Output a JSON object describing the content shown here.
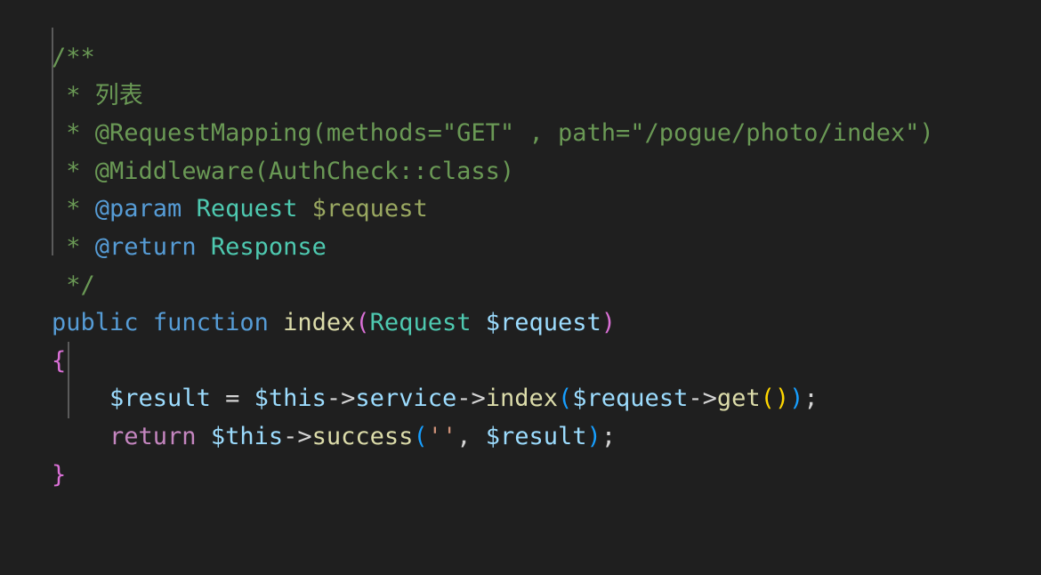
{
  "editor": {
    "language": "php",
    "background": "#1f1f1f",
    "font_size_px": 27,
    "line_height_px": 42.6,
    "theme": "dark-plus"
  },
  "colors": {
    "comment": "#6a9955",
    "doc_tag": "#569cd6",
    "doc_type": "#4ec9b0",
    "doc_variable": "#9aa861",
    "keyword": "#569cd6",
    "control_keyword": "#c586c0",
    "function": "#dcdcaa",
    "variable": "#9cdcfe",
    "string": "#ce9178",
    "operator": "#d4d4d4",
    "bracket_level_1": "#ffd700",
    "bracket_level_2": "#da70d6",
    "bracket_level_3": "#179fff",
    "indent_guide": "#5a5a5a"
  },
  "code": {
    "lines": [
      {
        "id": "line-1",
        "text": "/**"
      },
      {
        "id": "line-2",
        "text": " * 列表"
      },
      {
        "id": "line-3",
        "text": " * @RequestMapping(methods=\"GET\" , path=\"/pogue/photo/index\")"
      },
      {
        "id": "line-4",
        "text": " * @Middleware(AuthCheck::class)"
      },
      {
        "id": "line-5",
        "text": " * @param Request $request"
      },
      {
        "id": "line-6",
        "text": " * @return Response"
      },
      {
        "id": "line-7",
        "text": " */"
      },
      {
        "id": "line-8",
        "text": "public function index(Request $request)"
      },
      {
        "id": "line-9",
        "text": "{"
      },
      {
        "id": "line-10",
        "text": "    $result = $this->service->index($request->get());"
      },
      {
        "id": "line-11",
        "text": "    return $this->success('', $result);"
      },
      {
        "id": "line-12",
        "text": "}"
      }
    ],
    "tokens": {
      "comment_open": "/**",
      "comment_star": " * ",
      "comment_close": " */",
      "doc_summary": "列表",
      "annotation_request_mapping": "@RequestMapping(methods=\"GET\" , path=\"/pogue/photo/index\")",
      "annotation_middleware": "@Middleware(AuthCheck::class)",
      "tag_param": "@param",
      "tag_return": "@return",
      "type_request": "Request",
      "type_response": "Response",
      "doc_var_request": "$request",
      "kw_public": "public",
      "kw_function": "function",
      "fn_index": "index",
      "sig_type_request": "Request",
      "sig_var_request": "$request",
      "brace_open": "{",
      "brace_close": "}",
      "var_result": "$result",
      "assign": "=",
      "var_this": "$this",
      "arrow": "->",
      "prop_service": "service",
      "call_index": "index",
      "call_get": "get",
      "semicolon": ";",
      "kw_return": "return",
      "call_success": "success",
      "empty_string": "''",
      "comma": ",",
      "paren_open": "(",
      "paren_close": ")"
    }
  }
}
